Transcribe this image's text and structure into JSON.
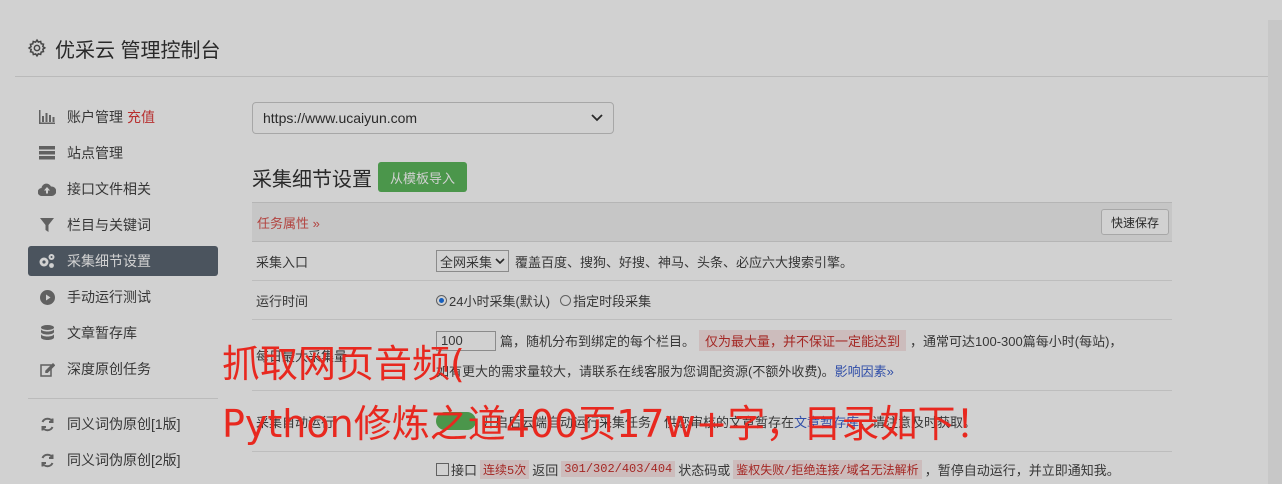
{
  "header": {
    "title": "优采云 管理控制台",
    "icon": "gear-icon"
  },
  "sidebar": {
    "items": [
      {
        "label": "账户管理",
        "badge": "充值",
        "icon": "bar-chart-icon"
      },
      {
        "label": "站点管理",
        "icon": "server-icon"
      },
      {
        "label": "接口文件相关",
        "icon": "cloud-upload-icon"
      },
      {
        "label": "栏目与关键词",
        "icon": "filter-icon"
      },
      {
        "label": "采集细节设置",
        "icon": "cogs-icon",
        "active": true
      },
      {
        "label": "手动运行测试",
        "icon": "play-circle-icon"
      },
      {
        "label": "文章暂存库",
        "icon": "database-icon"
      },
      {
        "label": "深度原创任务",
        "icon": "edit-icon"
      }
    ],
    "items2": [
      {
        "label": "同义词伪原创[1版]",
        "icon": "refresh-icon"
      },
      {
        "label": "同义词伪原创[2版]",
        "icon": "refresh-icon"
      }
    ]
  },
  "main": {
    "site_select": "https://www.ucaiyun.com",
    "section_title": "采集细节设置",
    "import_button": "从模板导入",
    "task_attr": "任务属性 »",
    "quick_save": "快速保存",
    "rows": {
      "entry": {
        "label": "采集入口",
        "select": "全网采集",
        "desc": "覆盖百度、搜狗、好搜、神马、头条、必应六大搜索引擎。"
      },
      "runtime": {
        "label": "运行时间",
        "opt1": "24小时采集(默认)",
        "opt2": "指定时段采集"
      },
      "daily": {
        "label": "每日最大采集量",
        "value": "100",
        "text1": "篇，随机分布到绑定的每个栏目。",
        "warn": "仅为最大量，并不保证一定能达到",
        "text2": "，通常可达100-300篇每小时(每站)，",
        "text3": "如有更大的需求量较大，请联系在线客服为您调配资源(不额外收费)。",
        "link": "影响因素»"
      },
      "auto": {
        "label": "采集自动运行",
        "text1": "开启后云端自动运行采集任务，",
        "text2": "供您审核的文章暂存在",
        "link": "文章暂存库",
        "text3": "，请注意及时获取。"
      },
      "stop": {
        "cb": "接口",
        "pink1": "连续5次",
        "text1": "返回",
        "codes": "301/302/403/404",
        "text2": "状态码或",
        "pink2": "鉴权失败/拒绝连接/域名无法解析",
        "text3": "，暂停自动运行，并立即通知我。"
      }
    }
  },
  "watermark": {
    "line1": "抓取网页音频(",
    "line2": "Python修炼之道400页17w+字，目录如下！"
  }
}
